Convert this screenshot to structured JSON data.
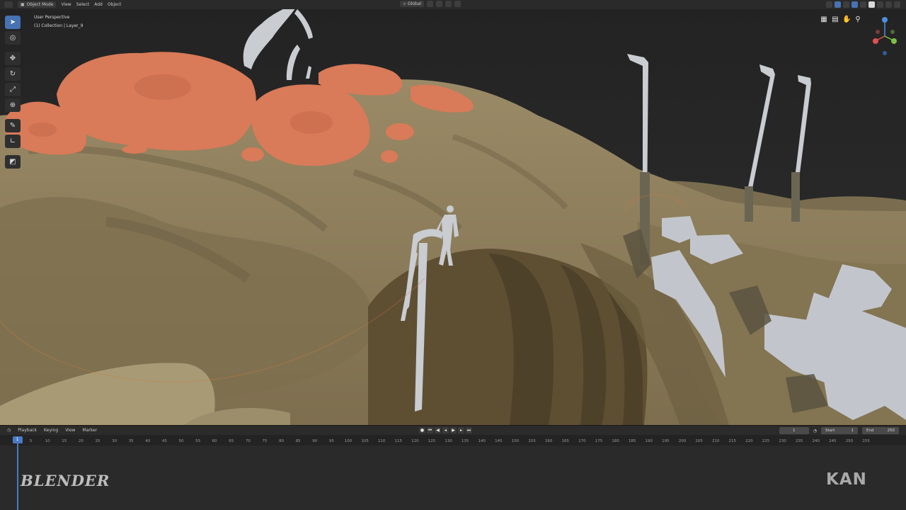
{
  "header": {
    "mode": "Object Mode",
    "menus": [
      "View",
      "Select",
      "Add",
      "Object"
    ],
    "transform_orientation": "Global"
  },
  "viewport": {
    "view_name": "User Perspective",
    "collection": "(1) Collection | Layer_9"
  },
  "toolbar": {
    "tools": [
      "select-box",
      "cursor",
      "move",
      "rotate",
      "scale",
      "transform",
      "annotate",
      "measure",
      "add-cube"
    ],
    "active_tool": "select-box"
  },
  "timeline": {
    "menus": [
      "Playback",
      "Keying",
      "View",
      "Marker"
    ],
    "current_frame": "1",
    "start_label": "Start",
    "start": "1",
    "end_label": "End",
    "end": "250",
    "ticks": [
      "0",
      "5",
      "10",
      "15",
      "20",
      "25",
      "30",
      "35",
      "40",
      "45",
      "50",
      "55",
      "60",
      "65",
      "70",
      "75",
      "80",
      "85",
      "90",
      "95",
      "100",
      "105",
      "110",
      "115",
      "120",
      "125",
      "130",
      "135",
      "140",
      "145",
      "150",
      "155",
      "160",
      "165",
      "170",
      "175",
      "180",
      "185",
      "190",
      "195",
      "200",
      "205",
      "210",
      "215",
      "220",
      "225",
      "230",
      "235",
      "240",
      "245",
      "250",
      "255"
    ],
    "playhead_label": "1"
  },
  "watermarks": {
    "left": "BLENDER",
    "right": "KAN"
  },
  "colors": {
    "terrain": "#8c7c5a",
    "rocks": "#d97a58",
    "props": "#c9ccd1",
    "accent": "#4772b3"
  }
}
